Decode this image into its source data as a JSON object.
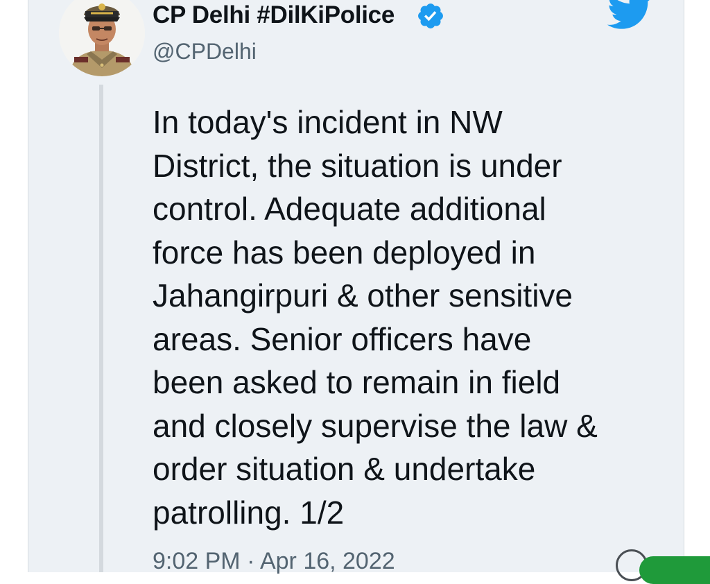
{
  "tweet": {
    "author": {
      "display_name": "CP Delhi #DilKiPolice",
      "handle": "@CPDelhi",
      "verified": true
    },
    "text": "In today's incident in NW\nDistrict, the situation is under\ncontrol. Adequate additional\nforce has been deployed in\nJahangirpuri & other sensitive\nareas. Senior officers have\nbeen asked to remain in field\nand closely supervise the law &\norder situation & undertake\npatrolling. 1/2",
    "timestamp": "9:02 PM · Apr 16, 2022"
  },
  "icons": {
    "verified": "verified-badge-icon",
    "brand": "twitter-bird-icon"
  },
  "colors": {
    "background": "#edf1f5",
    "text": "#0f1419",
    "secondary_text": "#536471",
    "twitter_blue": "#1d9bf0",
    "thread_line": "#d4d9de",
    "fab_green": "#1f9a3a"
  }
}
